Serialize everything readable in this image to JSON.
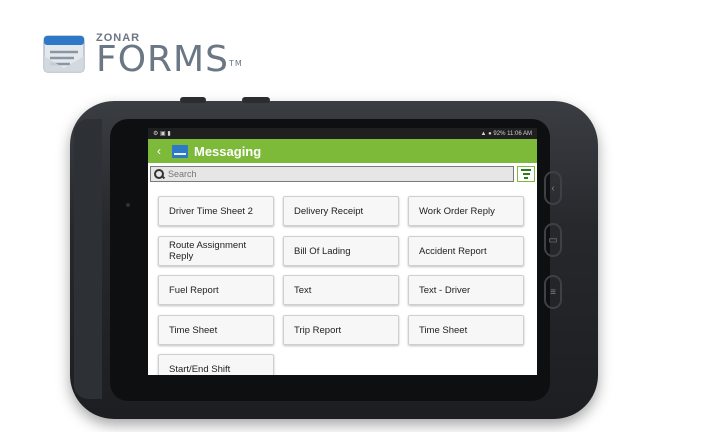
{
  "logo": {
    "brand": "ZONAR",
    "product": "FORMS",
    "tm": "TM"
  },
  "status_bar": {
    "left": "⚙ ▣ ▮",
    "right": "▲ ● 92% 11:06 AM"
  },
  "app_bar": {
    "title": "Messaging",
    "back_icon": "chevron-left-icon",
    "app_icon": "envelope-icon"
  },
  "search": {
    "placeholder": "Search"
  },
  "forms": [
    "Driver Time Sheet 2",
    "Delivery Receipt",
    "Work Order Reply",
    "Route Assignment Reply",
    "Bill Of Lading",
    "Accident Report",
    "Fuel Report",
    "Text",
    "Text - Driver",
    "Time Sheet",
    "Trip Report",
    "Time Sheet",
    "Start/End Shift"
  ],
  "colors": {
    "accent_green": "#7dba3a",
    "icon_blue": "#2d79c7"
  }
}
